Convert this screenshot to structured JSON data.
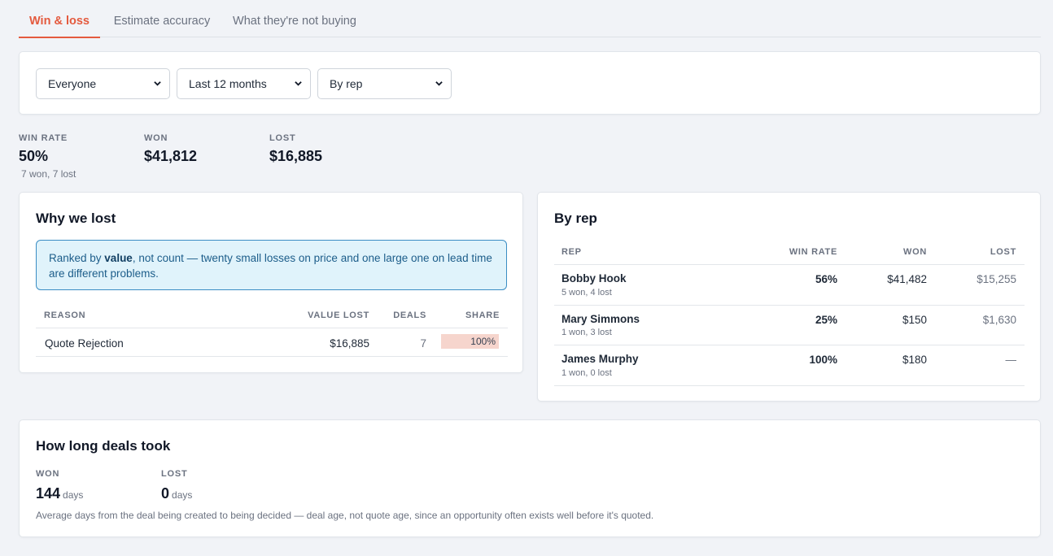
{
  "tabs": [
    "Win & loss",
    "Estimate accuracy",
    "What they're not buying"
  ],
  "filters": {
    "people": "Everyone",
    "period": "Last 12 months",
    "grouping": "By rep"
  },
  "summary": {
    "win_rate_label": "WIN RATE",
    "win_rate": "50%",
    "win_rate_sub": "7 won, 7 lost",
    "won_label": "WON",
    "won": "$41,812",
    "lost_label": "LOST",
    "lost": "$16,885"
  },
  "why_lost": {
    "title": "Why we lost",
    "note_prefix": "Ranked by ",
    "note_bold": "value",
    "note_suffix": ", not count — twenty small losses on price and one large one on lead time are different problems.",
    "columns": [
      "REASON",
      "VALUE LOST",
      "DEALS",
      "SHARE"
    ],
    "rows": [
      {
        "reason": "Quote Rejection",
        "value_lost": "$16,885",
        "deals": "7",
        "share": "100%",
        "share_fraction": 1.0
      }
    ]
  },
  "by_rep": {
    "title": "By rep",
    "columns": [
      "REP",
      "WIN RATE",
      "WON",
      "LOST"
    ],
    "rows": [
      {
        "name": "Bobby Hook",
        "sub": "5 won, 4 lost",
        "win_rate": "56%",
        "won": "$41,482",
        "lost": "$15,255"
      },
      {
        "name": "Mary Simmons",
        "sub": "1 won, 3 lost",
        "win_rate": "25%",
        "won": "$150",
        "lost": "$1,630"
      },
      {
        "name": "James Murphy",
        "sub": "1 won, 0 lost",
        "win_rate": "100%",
        "won": "$180",
        "lost": "—"
      }
    ]
  },
  "duration": {
    "title": "How long deals took",
    "won_label": "WON",
    "won_value": "144",
    "lost_label": "LOST",
    "lost_value": "0",
    "unit": "days",
    "footnote": "Average days from the deal being created to being decided — deal age, not quote age, since an opportunity often exists well before it's quoted."
  },
  "colors": {
    "accent": "#e45a3e",
    "info_bg": "#e0f3fb",
    "info_border": "#3b8dc4",
    "share_bar": "#f6d5cd"
  },
  "icons": {
    "select_chevron": "chevron-down-icon"
  }
}
